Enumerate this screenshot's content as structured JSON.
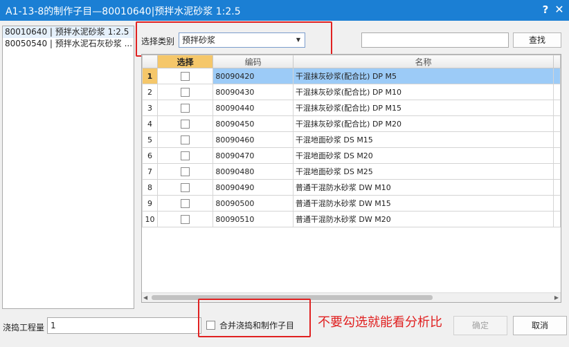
{
  "window": {
    "title": "A1-13-8的制作子目—80010640|预拌水泥砂浆 1:2.5",
    "help_glyph": "?",
    "close_glyph": "✕"
  },
  "left_list": {
    "items": [
      "80010640 | 预拌水泥砂浆 1:2.5",
      "80050540 | 预拌水泥石灰砂浆 ..."
    ]
  },
  "filter": {
    "category_label": "选择类别",
    "category_value": "预拌砂浆",
    "search_value": "",
    "search_button": "查找"
  },
  "grid": {
    "headers": {
      "select": "选择",
      "code": "编码",
      "name": "名称"
    },
    "active_row": 1,
    "rows": [
      {
        "n": "1",
        "code": "80090420",
        "name": "干混抹灰砂浆(配合比) DP M5"
      },
      {
        "n": "2",
        "code": "80090430",
        "name": "干混抹灰砂浆(配合比) DP M10"
      },
      {
        "n": "3",
        "code": "80090440",
        "name": "干混抹灰砂浆(配合比) DP M15"
      },
      {
        "n": "4",
        "code": "80090450",
        "name": "干混抹灰砂浆(配合比) DP M20"
      },
      {
        "n": "5",
        "code": "80090460",
        "name": "干混地面砂浆 DS M15"
      },
      {
        "n": "6",
        "code": "80090470",
        "name": "干混地面砂浆 DS M20"
      },
      {
        "n": "7",
        "code": "80090480",
        "name": "干混地面砂浆 DS M25"
      },
      {
        "n": "8",
        "code": "80090490",
        "name": "普通干混防水砂浆 DW M10"
      },
      {
        "n": "9",
        "code": "80090500",
        "name": "普通干混防水砂浆 DW M15"
      },
      {
        "n": "10",
        "code": "80090510",
        "name": "普通干混防水砂浆 DW M20"
      }
    ]
  },
  "footer": {
    "quantity_label": "浇捣工程量",
    "quantity_value": "1",
    "merge_label": "合并浇捣和制作子目",
    "annotation": "不要勾选就能看分析比",
    "ok_button": "确定",
    "cancel_button": "取消"
  },
  "colors": {
    "titlebar": "#1b7fd4",
    "highlight_row": "#9ccbf7",
    "header_select": "#f5c76a",
    "annotation_red": "#e02020"
  }
}
